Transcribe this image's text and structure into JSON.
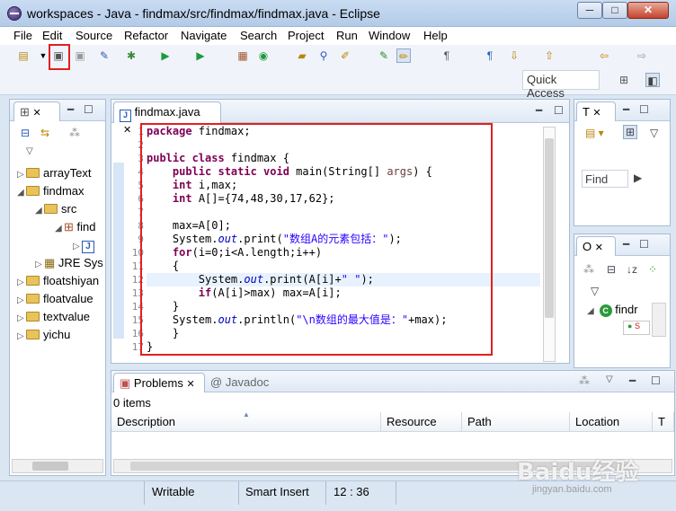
{
  "window": {
    "title": "workspaces - Java - findmax/src/findmax/findmax.java - Eclipse",
    "buttons": [
      "─",
      "□",
      "✕"
    ]
  },
  "menu": [
    "File",
    "Edit",
    "Source",
    "Refactor",
    "Navigate",
    "Search",
    "Project",
    "Run",
    "Window",
    "Help"
  ],
  "toolbar": {
    "quick_access": "Quick Access",
    "icons": [
      "new-icon",
      "save-icon",
      "save-all-icon",
      "pin-icon",
      "debug-icon",
      "run-icon",
      "external-tools-icon",
      "new-java-project-icon",
      "new-class-icon",
      "open-type-icon",
      "search-icon",
      "pen-icon",
      "mark-occurrences-icon",
      "block-selection-icon",
      "show-whitespace-icon",
      "next-annotation-icon",
      "prev-annotation-icon",
      "back-icon",
      "forward-icon"
    ]
  },
  "package_explorer": {
    "tree": [
      {
        "label": "arrayText",
        "level": 0
      },
      {
        "label": "findmax",
        "level": 0
      },
      {
        "label": "src",
        "level": 1
      },
      {
        "label": "find",
        "level": 2
      },
      {
        "label": "",
        "level": 3
      },
      {
        "label": "JRE Sys",
        "level": 1
      },
      {
        "label": "floatshiyan",
        "level": 0
      },
      {
        "label": "floatvalue",
        "level": 0
      },
      {
        "label": "textvalue",
        "level": 0
      },
      {
        "label": "yichu",
        "level": 0
      }
    ]
  },
  "editor": {
    "tab_label": "findmax.java",
    "line_numbers": [
      "1",
      "2",
      "3",
      "4",
      "5",
      "6",
      "7",
      "8",
      "9",
      "10",
      "11",
      "12",
      "13",
      "14",
      "15",
      "16",
      "17"
    ]
  },
  "task_panel": {
    "tab_label": "T",
    "find_placeholder": "Find"
  },
  "outline_panel": {
    "tab_label": "O",
    "item_label": "findr",
    "item_badge": "S"
  },
  "bottom_panel": {
    "tabs": [
      "Problems",
      "Javadoc"
    ],
    "count": "0 items",
    "columns": [
      "Description",
      "Resource",
      "Path",
      "Location",
      "T"
    ]
  },
  "status_bar": {
    "mode": "Writable",
    "insert": "Smart Insert",
    "position": "12 : 36"
  },
  "watermark": {
    "text": "Baidu经验",
    "url": "jingyan.baidu.com"
  }
}
